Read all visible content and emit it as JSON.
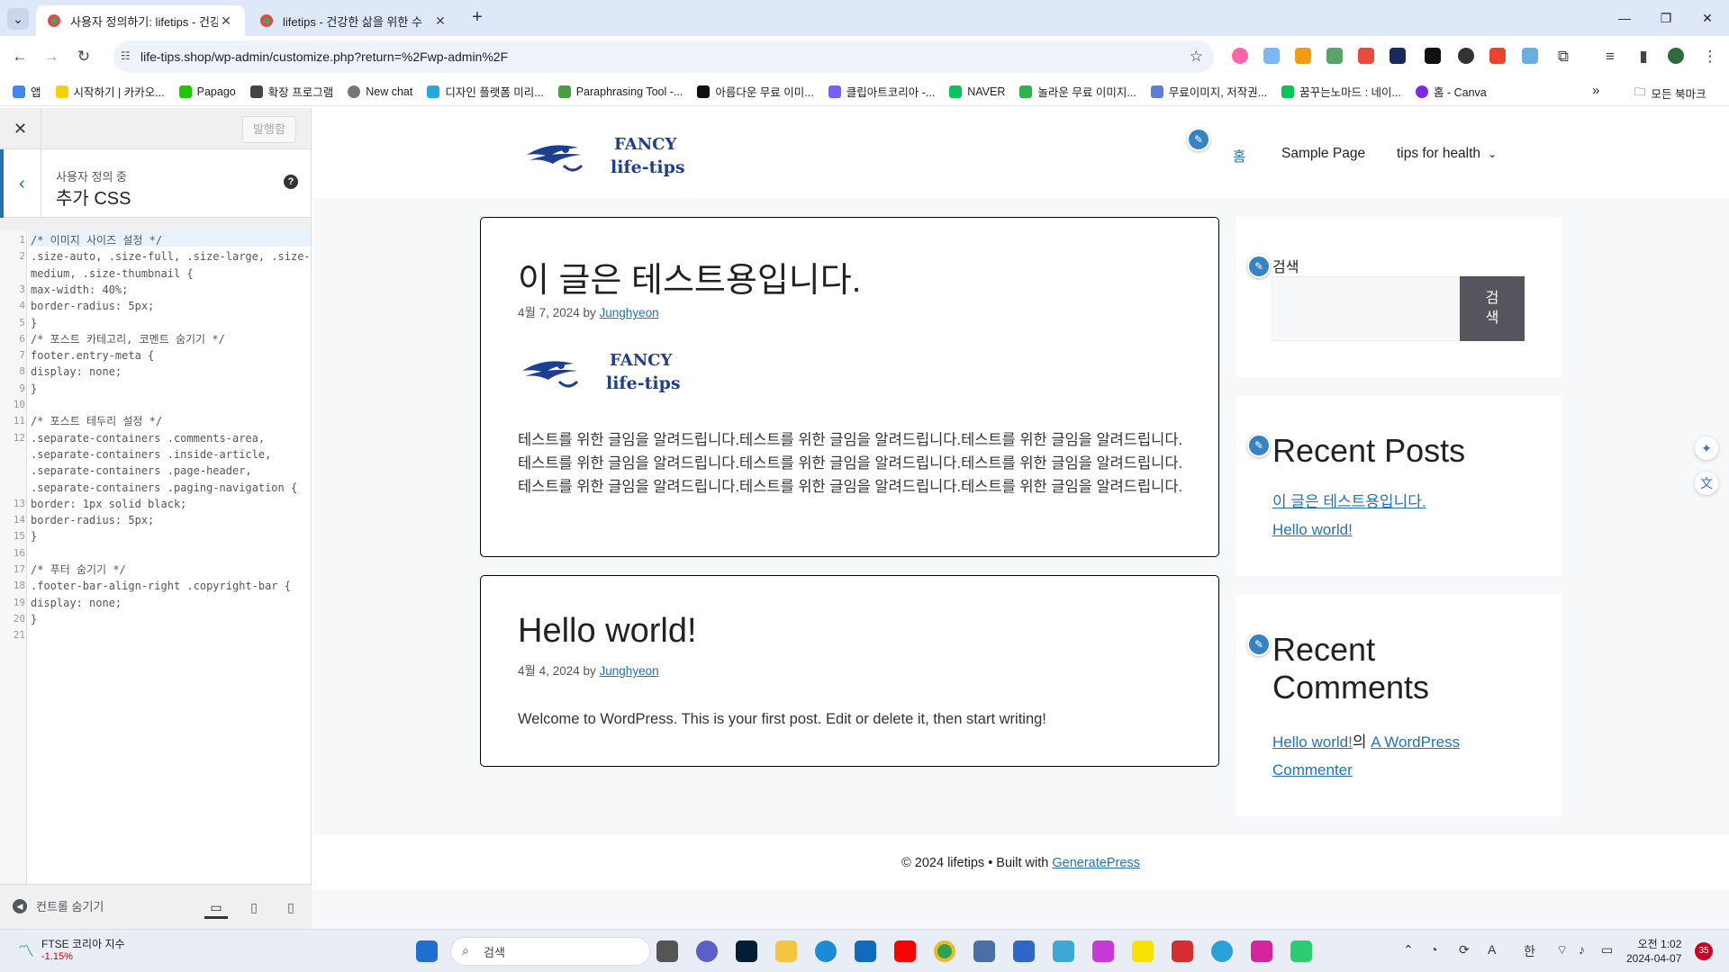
{
  "browser": {
    "tabs": [
      {
        "title": "사용자 정의하기: lifetips - 건강",
        "active": true
      },
      {
        "title": "lifetips - 건강한 삶을 위한 수",
        "active": false
      }
    ],
    "url": "life-tips.shop/wp-admin/customize.php?return=%2Fwp-admin%2F",
    "bookmarks": [
      {
        "label": "앱",
        "color": "#4285f4"
      },
      {
        "label": "시작하기 | 카카오...",
        "color": "#f7d200"
      },
      {
        "label": "Papago",
        "color": "#1ec800"
      },
      {
        "label": "확장 프로그램",
        "color": "#444444"
      },
      {
        "label": "New chat",
        "color": "#777777"
      },
      {
        "label": "디자인 플랫폼 미리...",
        "color": "#23a8e0"
      },
      {
        "label": "Paraphrasing Tool -...",
        "color": "#499e3e"
      },
      {
        "label": "아름다운 무료 이미...",
        "color": "#111111"
      },
      {
        "label": "클립아트코리아 -...",
        "color": "#7a5cff"
      },
      {
        "label": "NAVER",
        "color": "#03c75a"
      },
      {
        "label": "놀라운 무료 이미지...",
        "color": "#2bb44b"
      },
      {
        "label": "무료이미지, 저작권...",
        "color": "#5b7ed6"
      },
      {
        "label": "꿈꾸는노마드 : 네이...",
        "color": "#03c75a"
      },
      {
        "label": "홈 - Canva",
        "color": "#7d2ae8"
      }
    ],
    "bookmarks_more": "»",
    "all_bookmarks": "모든 북마크"
  },
  "customizer": {
    "publish_label": "발행함",
    "section_sub": "사용자 정의 중",
    "section_title": "추가 CSS",
    "hide_controls": "컨트롤 숨기기",
    "code_lines": [
      {
        "n": "1",
        "t": "/* 이미지 사이즈 설정 */"
      },
      {
        "n": "2",
        "t": ".size-auto, .size-full, .size-large, .size-"
      },
      {
        "n": "",
        "t": "medium, .size-thumbnail {"
      },
      {
        "n": "3",
        "t": "  max-width: 40%;"
      },
      {
        "n": "4",
        "t": "  border-radius: 5px;"
      },
      {
        "n": "5",
        "t": "}"
      },
      {
        "n": "6",
        "t": "/* 포스트 카테고리, 코멘트 숨기기 */"
      },
      {
        "n": "7",
        "t": "footer.entry-meta {"
      },
      {
        "n": "8",
        "t": "  display: none;"
      },
      {
        "n": "9",
        "t": "}"
      },
      {
        "n": "10",
        "t": ""
      },
      {
        "n": "11",
        "t": "/* 포스트 테두리 설정 */"
      },
      {
        "n": "12",
        "t": ".separate-containers .comments-area,"
      },
      {
        "n": "",
        "t": ".separate-containers .inside-article,"
      },
      {
        "n": "",
        "t": ".separate-containers .page-header,"
      },
      {
        "n": "",
        "t": ".separate-containers .paging-navigation {"
      },
      {
        "n": "13",
        "t": "  border: 1px solid black;"
      },
      {
        "n": "14",
        "t": "  border-radius: 5px;"
      },
      {
        "n": "15",
        "t": "}"
      },
      {
        "n": "16",
        "t": ""
      },
      {
        "n": "17",
        "t": "/* 푸터 숨기기 */"
      },
      {
        "n": "18",
        "t": ".footer-bar-align-right .copyright-bar {"
      },
      {
        "n": "19",
        "t": "    display: none;"
      },
      {
        "n": "20",
        "t": "}"
      },
      {
        "n": "21",
        "t": ""
      }
    ]
  },
  "site": {
    "logo_line1": "FANCY",
    "logo_line2": "life-tips",
    "menu": [
      "홈",
      "Sample Page",
      "tips for health"
    ],
    "posts": [
      {
        "title": "이 글은 테스트용입니다.",
        "date": "4월 7, 2024",
        "by": "by",
        "author": "Junghyeon",
        "body": "테스트를 위한 글임을 알려드립니다.테스트를 위한 글임을 알려드립니다.테스트를 위한 글임을 알려드립니다.테스트를 위한 글임을 알려드립니다.테스트를 위한 글임을 알려드립니다.테스트를 위한 글임을 알려드립니다.테스트를 위한 글임을 알려드립니다.테스트를 위한 글임을 알려드립니다.테스트를 위한 글임을 알려드립니다."
      },
      {
        "title": "Hello world!",
        "date": "4월 4, 2024",
        "by": "by",
        "author": "Junghyeon",
        "body": "Welcome to WordPress. This is your first post. Edit or delete it, then start writing!"
      }
    ],
    "search_widget": {
      "label": "검색",
      "button": "검색"
    },
    "recent_posts": {
      "title": "Recent Posts",
      "items": [
        "이 글은 테스트용입니다.",
        "Hello world!"
      ]
    },
    "recent_comments": {
      "title": "Recent Comments",
      "link1": "Hello world!",
      "mid": "의",
      "link2": "A WordPress Commenter"
    },
    "footer": {
      "text": "© 2024 lifetips • Built with",
      "link": "GeneratePress"
    }
  },
  "taskbar": {
    "widget_title": "FTSE 코리아 지수",
    "widget_change": "-1.15%",
    "search_placeholder": "검색",
    "time": "오전 1:02",
    "date": "2024-04-07",
    "badge": "35"
  }
}
